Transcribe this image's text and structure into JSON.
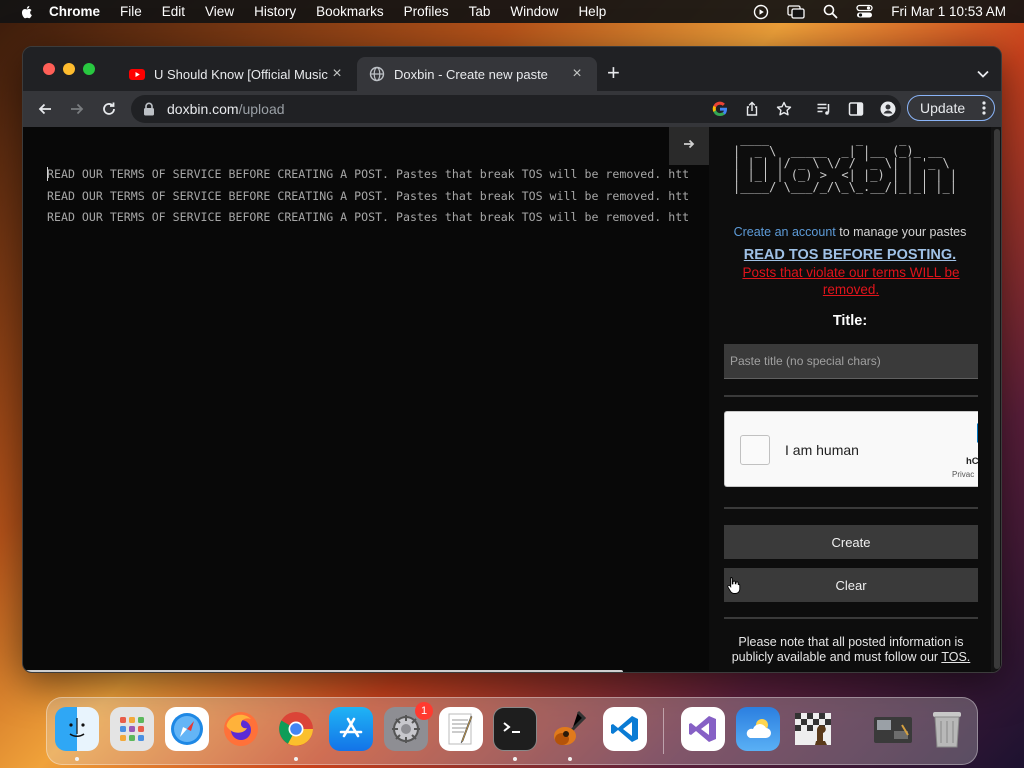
{
  "menubar": {
    "app_name": "Chrome",
    "items": [
      "File",
      "Edit",
      "View",
      "History",
      "Bookmarks",
      "Profiles",
      "Tab",
      "Window",
      "Help"
    ],
    "clock": "Fri Mar 1  10:53 AM"
  },
  "browser": {
    "tabs": [
      {
        "title": "U Should Know [Official Music",
        "favicon": "youtube-icon",
        "active": false
      },
      {
        "title": "Doxbin - Create new paste",
        "favicon": "globe-icon",
        "active": true
      }
    ],
    "url_host": "doxbin.com",
    "url_path": "/upload",
    "update_label": "Update"
  },
  "editor": {
    "lines": [
      "READ OUR TERMS OF SERVICE BEFORE CREATING A POST. Pastes that break TOS will be removed. htt",
      "READ OUR TERMS OF SERVICE BEFORE CREATING A POST. Pastes that break TOS will be removed. htt",
      "READ OUR TERMS OF SERVICE BEFORE CREATING A POST. Pastes that break TOS will be removed. htt"
    ]
  },
  "sidebar": {
    "logo_text": "Doxbin",
    "account_link": "Create an account",
    "account_suffix": " to manage your pastes",
    "tos_heading": "READ TOS BEFORE POSTING.",
    "tos_warning": "Posts that violate our terms WILL be removed.",
    "title_label": "Title:",
    "title_placeholder": "Paste title (no special chars)",
    "title_value": "",
    "captcha_label": "I am human",
    "captcha_brand": "hC",
    "captcha_privacy": "Privac",
    "create_label": "Create",
    "clear_label": "Clear",
    "note_text": "Please note that all posted information is publicly available and must follow our ",
    "note_link": "TOS."
  },
  "dock": {
    "apps": [
      "Finder",
      "Launchpad",
      "Safari",
      "Firefox",
      "Google Chrome",
      "App Store",
      "System Settings",
      "TextEdit",
      "Terminal",
      "GarageBand",
      "Visual Studio Code",
      "Visual Studio",
      "Weather",
      "Chess",
      "Screenshot",
      "Trash"
    ],
    "settings_badge": "1"
  },
  "colors": {
    "accent_link": "#5d9bd8",
    "warning_red": "#e0141b",
    "update_border": "#8ab4f8"
  }
}
